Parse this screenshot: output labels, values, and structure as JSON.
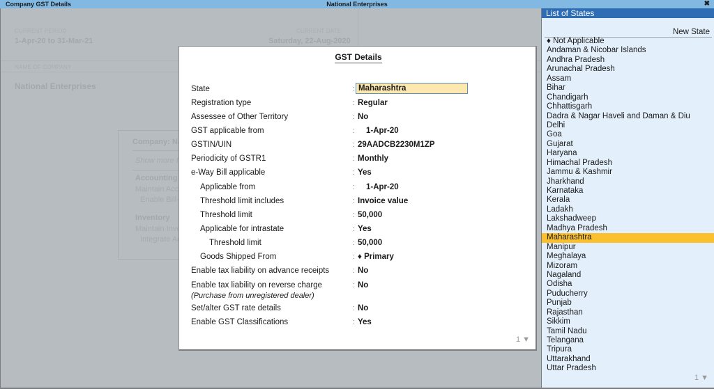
{
  "titlebar": {
    "left": "Company GST Details",
    "center": "National Enterprises",
    "close": "✖"
  },
  "background": {
    "current_period_label": "CURRENT PERIOD",
    "current_period": "1-Apr-20 to 31-Mar-21",
    "current_date_label": "CURRENT DATE",
    "current_date": "Saturday, 22-Aug-2020",
    "name_label": "NAME OF COMPANY",
    "company_name": "National Enterprises",
    "features": {
      "title": "Company: National Enterprises",
      "show_more": "Show more features",
      "accounting": "Accounting",
      "maintain_accounts": "Maintain Accounts",
      "enable_bill": "Enable Bill-wise entry",
      "inventory": "Inventory",
      "maintain_inventory": "Maintain Inventory",
      "integrate": "Integrate Accounts with Inventory"
    }
  },
  "dialog": {
    "title": "GST Details",
    "rows": [
      {
        "label": "State",
        "value": "Maharashtra"
      },
      {
        "label": "Registration type",
        "value": "Regular"
      },
      {
        "label": "Assessee of Other Territory",
        "value": "No"
      },
      {
        "label": "GST applicable from",
        "value": "1-Apr-20"
      },
      {
        "label": "GSTIN/UIN",
        "value": "29AADCB2230M1ZP"
      },
      {
        "label": "Periodicity of GSTR1",
        "value": "Monthly"
      },
      {
        "label": "e-Way Bill applicable",
        "value": "Yes"
      },
      {
        "label": "Applicable from",
        "value": "1-Apr-20"
      },
      {
        "label": "Threshold limit includes",
        "value": "Invoice value"
      },
      {
        "label": "Threshold limit",
        "value": "50,000"
      },
      {
        "label": "Applicable for intrastate",
        "value": "Yes"
      },
      {
        "label": "Threshold limit",
        "value": "50,000"
      },
      {
        "label": "Goods Shipped From",
        "value": "♦ Primary"
      },
      {
        "label": "Enable tax liability on advance receipts",
        "value": "No"
      },
      {
        "label": "Enable tax liability on reverse charge",
        "sublabel": "(Purchase from unregistered dealer)",
        "value": "No"
      },
      {
        "label": "Set/alter GST rate details",
        "value": "No"
      },
      {
        "label": "Enable GST Classifications",
        "value": "Yes"
      }
    ],
    "colon": ":",
    "page_indicator": "1 ▼"
  },
  "states_panel": {
    "title": "List of States",
    "new_state": "New State",
    "selected": "Maharashtra",
    "items": [
      "♦ Not Applicable",
      "Andaman & Nicobar Islands",
      "Andhra Pradesh",
      "Arunachal Pradesh",
      "Assam",
      "Bihar",
      "Chandigarh",
      "Chhattisgarh",
      "Dadra & Nagar Haveli and Daman & Diu",
      "Delhi",
      "Goa",
      "Gujarat",
      "Haryana",
      "Himachal Pradesh",
      "Jammu & Kashmir",
      "Jharkhand",
      "Karnataka",
      "Kerala",
      "Ladakh",
      "Lakshadweep",
      "Madhya Pradesh",
      "Maharashtra",
      "Manipur",
      "Meghalaya",
      "Mizoram",
      "Nagaland",
      "Odisha",
      "Puducherry",
      "Punjab",
      "Rajasthan",
      "Sikkim",
      "Tamil Nadu",
      "Telangana",
      "Tripura",
      "Uttarakhand",
      "Uttar Pradesh"
    ],
    "page_indicator": "1 ▼"
  }
}
